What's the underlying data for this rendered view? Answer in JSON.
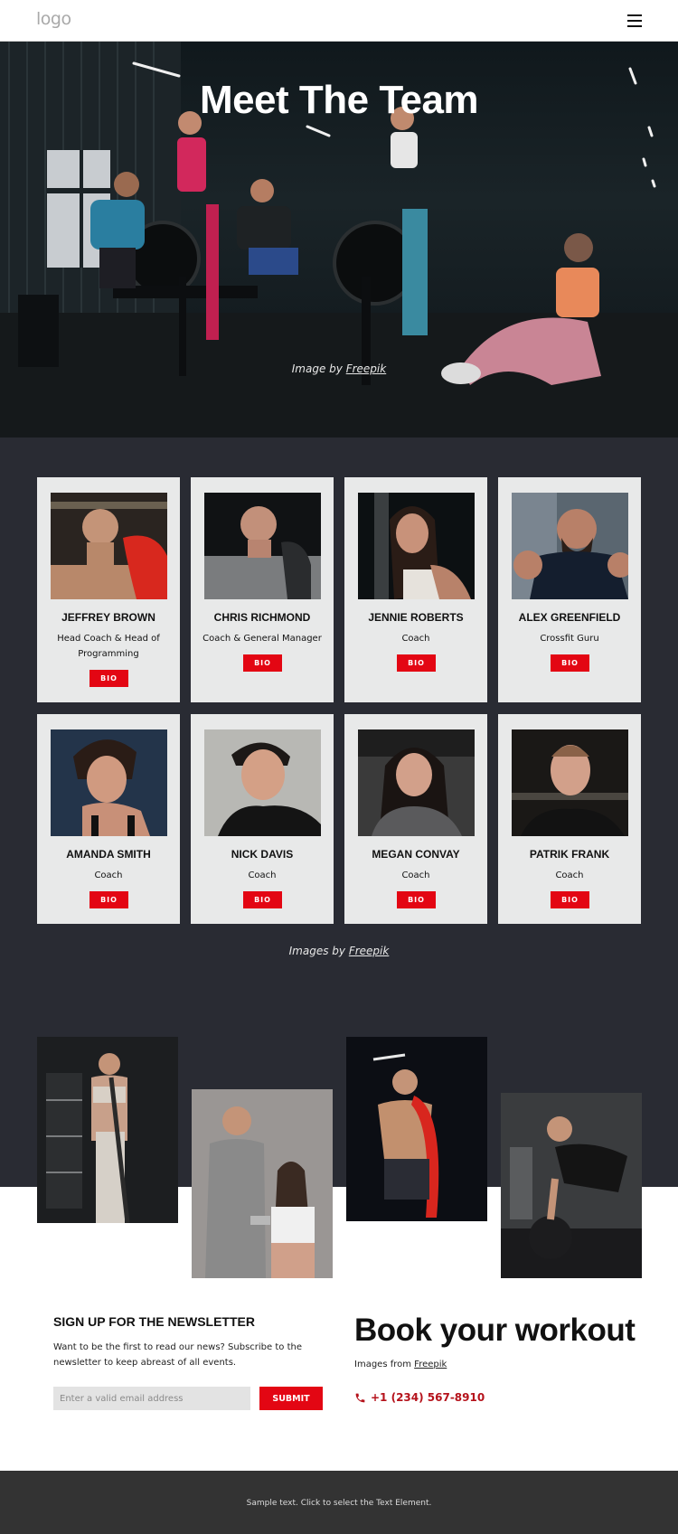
{
  "header": {
    "logo_text": "logo",
    "menu_icon": "hamburger-menu-icon"
  },
  "hero": {
    "title": "Meet The Team",
    "credit_prefix": "Image by ",
    "credit_link": "Freepik"
  },
  "team": {
    "members": [
      {
        "name": "JEFFREY BROWN",
        "role": "Head Coach & Head of Programming",
        "bio_label": "BIO"
      },
      {
        "name": "CHRIS RICHMOND",
        "role": "Coach & General Manager",
        "bio_label": "BIO"
      },
      {
        "name": "JENNIE ROBERTS",
        "role": "Coach",
        "bio_label": "BIO"
      },
      {
        "name": "ALEX GREENFIELD",
        "role": "Crossfit Guru",
        "bio_label": "BIO"
      },
      {
        "name": "AMANDA SMITH",
        "role": "Coach",
        "bio_label": "BIO"
      },
      {
        "name": "NICK DAVIS",
        "role": "Coach",
        "bio_label": "BIO"
      },
      {
        "name": "MEGAN CONVAY",
        "role": "Coach",
        "bio_label": "BIO"
      },
      {
        "name": "PATRIK FRANK",
        "role": "Coach",
        "bio_label": "BIO"
      }
    ],
    "credit_prefix": "Images by ",
    "credit_link": "Freepik"
  },
  "newsletter": {
    "title": "SIGN UP FOR THE NEWSLETTER",
    "description": "Want to be the first to read our news? Subscribe to the newsletter to keep abreast of all events.",
    "email_placeholder": "Enter a valid email address",
    "email_value": "",
    "submit_label": "SUBMIT"
  },
  "booking": {
    "title": "Book your workout",
    "credit_prefix": "Images from ",
    "credit_link": "Freepik",
    "phone_icon": "phone-icon",
    "phone": "+1 (234) 567-8910"
  },
  "footer": {
    "text": "Sample text. Click to select the Text Element."
  },
  "colors": {
    "accent": "#e30613",
    "phone": "#b5121b",
    "team_bg": "#292b33",
    "card_bg": "#e8e9e9",
    "footer_bg": "#333333"
  }
}
